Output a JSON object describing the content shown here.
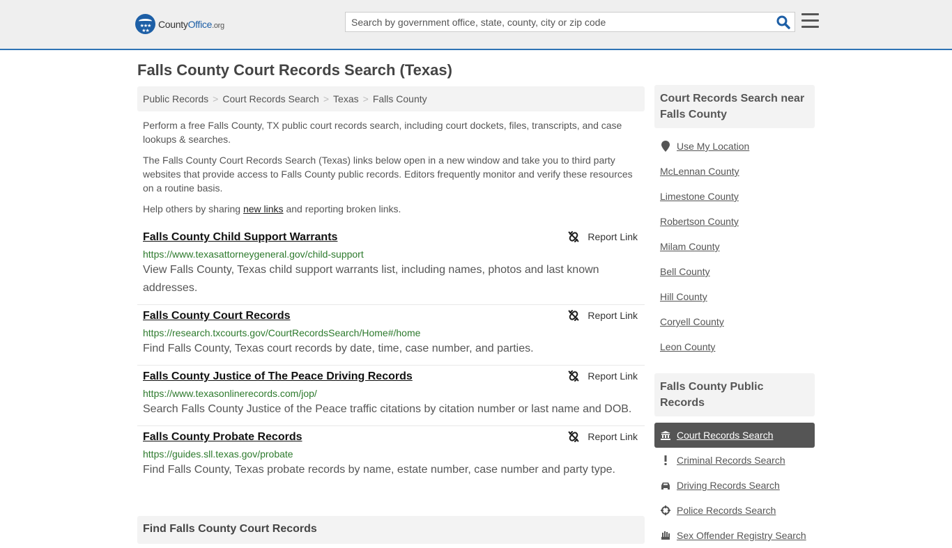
{
  "header": {
    "logo": {
      "county": "County",
      "office": "Office",
      "tld": ".org"
    },
    "search_placeholder": "Search by government office, state, county, city or zip code",
    "search_value": ""
  },
  "page_title": "Falls County Court Records Search (Texas)",
  "breadcrumb": [
    "Public Records",
    "Court Records Search",
    "Texas",
    "Falls County"
  ],
  "breadcrumb_separator": ">",
  "intro": {
    "p1": "Perform a free Falls County, TX public court records search, including court dockets, files, transcripts, and case lookups & searches.",
    "p2": "The Falls County Court Records Search (Texas) links below open in a new window and take you to third party websites that provide access to Falls County public records. Editors frequently monitor and verify these resources on a routine basis.",
    "p3_before": "Help others by sharing ",
    "p3_link": "new links",
    "p3_after": " and reporting broken links."
  },
  "report_label": "Report Link",
  "results": [
    {
      "title": "Falls County Child Support Warrants",
      "url": "https://www.texasattorneygeneral.gov/child-support",
      "description": "View Falls County, Texas child support warrants list, including names, photos and last known addresses."
    },
    {
      "title": "Falls County Court Records",
      "url": "https://research.txcourts.gov/CourtRecordsSearch/Home#/home",
      "description": "Find Falls County, Texas court records by date, time, case number, and parties."
    },
    {
      "title": "Falls County Justice of The Peace Driving Records",
      "url": "https://www.texasonlinerecords.com/jop/",
      "description": "Search Falls County Justice of the Peace traffic citations by citation number or last name and DOB."
    },
    {
      "title": "Falls County Probate Records",
      "url": "https://guides.sll.texas.gov/probate",
      "description": "Find Falls County, Texas probate records by name, estate number, case number and party type."
    }
  ],
  "find_section_title": "Find Falls County Court Records",
  "sidebar": {
    "nearby_title": "Court Records Search near Falls County",
    "use_location": "Use My Location",
    "nearby": [
      "McLennan County",
      "Limestone County",
      "Robertson County",
      "Milam County",
      "Bell County",
      "Hill County",
      "Coryell County",
      "Leon County"
    ],
    "public_records_title": "Falls County Public Records",
    "public_records": [
      {
        "label": "Court Records Search",
        "icon": "courthouse-icon",
        "active": true
      },
      {
        "label": "Criminal Records Search",
        "icon": "exclamation-icon",
        "active": false
      },
      {
        "label": "Driving Records Search",
        "icon": "car-icon",
        "active": false
      },
      {
        "label": "Police Records Search",
        "icon": "crosshair-icon",
        "active": false
      },
      {
        "label": "Sex Offender Registry Search",
        "icon": "hand-icon",
        "active": false
      }
    ]
  },
  "colors": {
    "accent": "#2f74b5",
    "url_green": "#2d7a2d",
    "active_bg": "#555555",
    "panel_bg": "#f3f3f3"
  }
}
